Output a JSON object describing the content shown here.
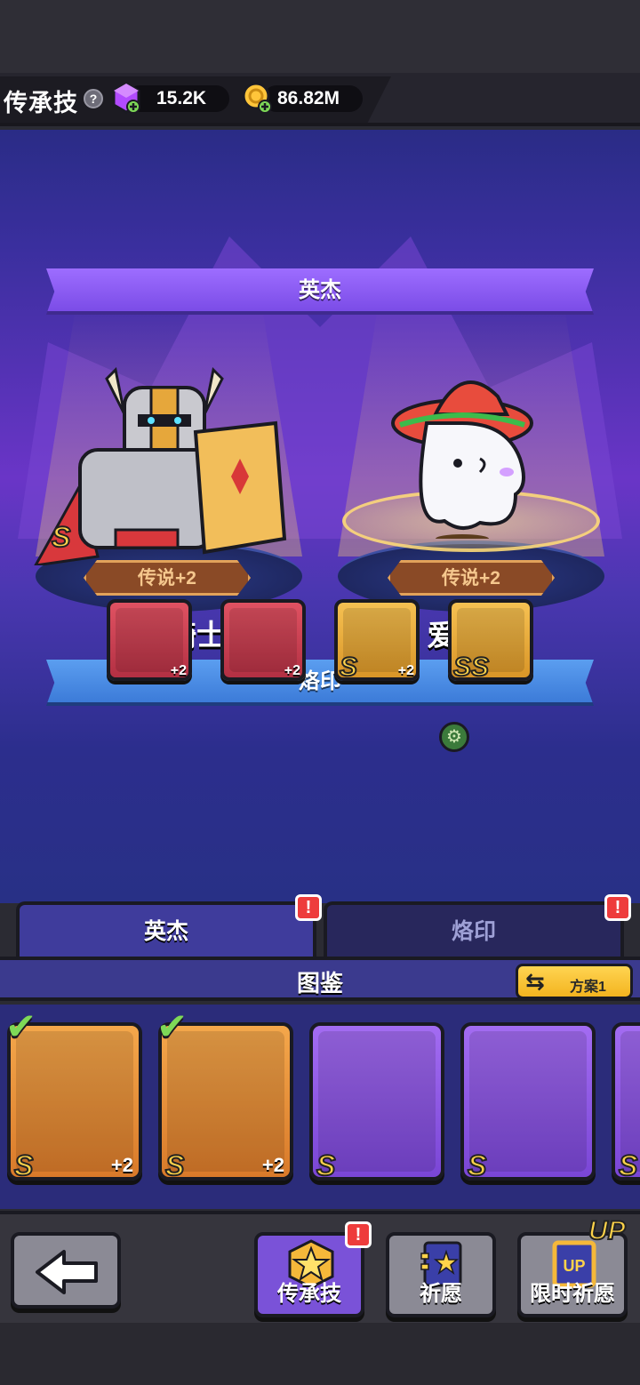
{
  "header": {
    "title": "传承技",
    "help_glyph": "?",
    "gems": "15.2K",
    "gold": "86.82M"
  },
  "featured": {
    "heroes_label": "英杰",
    "marks_label": "烙印",
    "heroes": [
      {
        "name": "终焉骑士",
        "rank": "传说+2",
        "grade": "S"
      },
      {
        "name": "爱哭鬼",
        "rank": "传说+2",
        "grade": ""
      }
    ],
    "marks": [
      {
        "grade": "",
        "plus": "+2",
        "color": "red"
      },
      {
        "grade": "",
        "plus": "+2",
        "color": "red"
      },
      {
        "grade": "S",
        "plus": "+2",
        "color": "gold"
      },
      {
        "grade": "SS",
        "plus": "",
        "color": "gold"
      }
    ]
  },
  "tabs": {
    "heroes": "英杰",
    "marks": "烙印",
    "alert_glyph": "!"
  },
  "collection": {
    "title": "图鉴",
    "plan_label": "方案1",
    "cards": [
      {
        "grade": "S",
        "plus": "+2",
        "checked": true,
        "color": "orange"
      },
      {
        "grade": "S",
        "plus": "+2",
        "checked": true,
        "color": "orange"
      },
      {
        "grade": "S",
        "plus": "",
        "checked": false,
        "color": "purple"
      },
      {
        "grade": "S",
        "plus": "",
        "checked": false,
        "color": "purple"
      },
      {
        "grade": "S",
        "plus": "",
        "checked": false,
        "color": "purple"
      }
    ]
  },
  "footer": {
    "back_label": "",
    "legacy_label": "传承技",
    "wish_label": "祈愿",
    "limited_wish_label": "限时祈愿",
    "up_badge": "UP",
    "limited_icon_text": "UP"
  },
  "colors": {
    "accent_purple": "#7b4ce7",
    "accent_blue": "#3c7bd8",
    "gold": "#ffd34a",
    "alert_red": "#ee3c3c"
  }
}
